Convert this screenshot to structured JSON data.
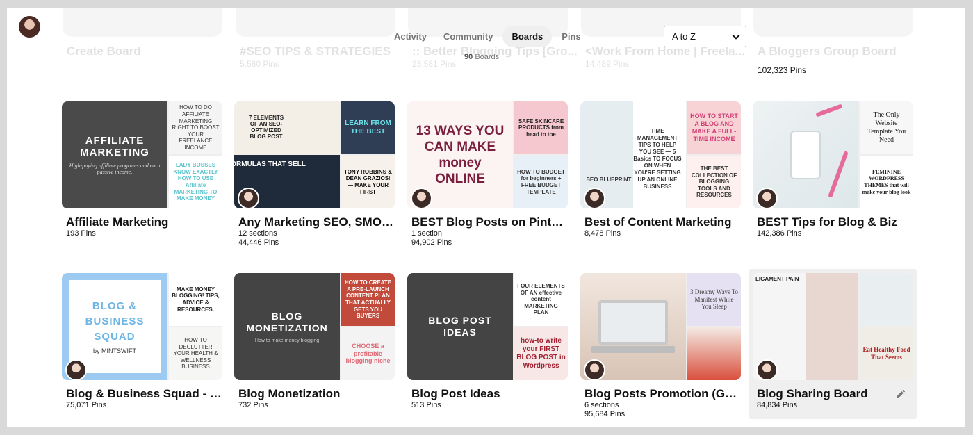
{
  "header": {
    "tabs": [
      {
        "label": "Activity"
      },
      {
        "label": "Community"
      },
      {
        "label": "Boards"
      },
      {
        "label": "Pins"
      }
    ],
    "count_number": "90",
    "count_unit": "Boards",
    "sort_value": "A to Z"
  },
  "faded_row": [
    {
      "title": "Create Board",
      "sub": ""
    },
    {
      "title": "#SEO TIPS & STRATEGIES",
      "sub": "5,580 Pins"
    },
    {
      "title": ":: Better Blogging Tips [Gro...",
      "sub": "23,581 Pins"
    },
    {
      "title": "<Work From Home | Freela...",
      "sub": "14,489 Pins"
    },
    {
      "title": "A Bloggers Group Board",
      "sub": ""
    }
  ],
  "faded_row_pins_visible": "102,323 Pins",
  "boards": [
    {
      "title": "Affiliate Marketing",
      "line1": "193 Pins",
      "line2": "",
      "main": {
        "heading": "AFFILIATE MARKETING",
        "sub": "High-paying affiliate programs and earn passive income."
      },
      "side_a": "HOW TO DO AFFILIATE MARKETING RIGHT TO BOOST YOUR FREELANCE INCOME",
      "side_b": "LADY BOSSES KNOW EXACTLY HOW TO USE Affiliate MARKETING TO MAKE MONEY"
    },
    {
      "title": "Any Marketing SEO, SMO A...",
      "line1": "12 sections",
      "line2": "44,446 Pins",
      "main": {
        "heading": "7 ELEMENTS OF AN SEO-OPTIMIZED BLOG POST",
        "sub": "FORMULAS THAT SELL"
      },
      "side_a": "LEARN FROM THE BEST",
      "side_b": "TONY ROBBINS & DEAN GRAZIOSI — MAKE YOUR FIRST"
    },
    {
      "title": "BEST Blog Posts on Pinterest",
      "line1": "1 section",
      "line2": "94,902 Pins",
      "main": {
        "heading": "13 WAYS YOU CAN MAKE money ONLINE",
        "sub": ""
      },
      "side_a": "SAFE SKINCARE PRODUCTS from head to toe",
      "side_b": "HOW TO BUDGET for beginners + FREE BUDGET TEMPLATE"
    },
    {
      "title": "Best of Content Marketing",
      "line1": "8,478 Pins",
      "line2": "",
      "main": {
        "heading": "TIME MANAGEMENT TIPS TO HELP YOU SEE — 5 Basics TO FOCUS ON WHEN YOU'RE SETTING UP AN ONLINE BUSINESS",
        "sub": "SEO BLUEPRINT"
      },
      "side_a": "HOW TO START A BLOG AND MAKE A FULL-TIME INCOME",
      "side_b": "THE BEST COLLECTION OF BLOGGING TOOLS AND RESOURCES"
    },
    {
      "title": "BEST Tips for Blog & Biz",
      "line1": "142,386 Pins",
      "line2": "",
      "main": {
        "heading": "",
        "sub": ""
      },
      "side_a": "The Only Website Template You Need",
      "side_b": "FEMININE WORDPRESS THEMES that will make your blog look"
    },
    {
      "title": "Blog & Business Squad - M...",
      "line1": "75,071 Pins",
      "line2": "",
      "main": {
        "heading": "BLOG & BUSINESS SQUAD",
        "sub": "by MINTSWIFT"
      },
      "side_a": "MAKE MONEY BLOGGING! TIPS, ADVICE & RESOURCES.",
      "side_b": "HOW TO DECLUTTER YOUR HEALTH & WELLNESS BUSINESS"
    },
    {
      "title": "Blog Monetization",
      "line1": "732 Pins",
      "line2": "",
      "main": {
        "heading": "BLOG MONETIZATION",
        "sub": "How to make money blogging"
      },
      "side_a": "HOW TO CREATE A PRE-LAUNCH CONTENT PLAN THAT ACTUALLY GETS YOU BUYERS",
      "side_b": "CHOOSE a profitable blogging niche"
    },
    {
      "title": "Blog Post Ideas",
      "line1": "513 Pins",
      "line2": "",
      "main": {
        "heading": "BLOG POST IDEAS",
        "sub": ""
      },
      "side_a": "FOUR ELEMENTS OF AN effective content MARKETING PLAN",
      "side_b": "how-to write your FIRST BLOG POST in Wordpress"
    },
    {
      "title": "Blog Posts Promotion (Gro...",
      "line1": "6 sections",
      "line2": "95,684 Pins",
      "main": {
        "heading": "",
        "sub": ""
      },
      "side_a": "3 Dreamy Ways To Manifest While You Sleep",
      "side_b": ""
    },
    {
      "title": "Blog Sharing Board",
      "line1": "84,834 Pins",
      "line2": "",
      "main": {
        "heading": "LIGAMENT PAIN",
        "sub": ""
      },
      "side_a": "",
      "side_b": "Eat Healthy Food That Seems"
    }
  ],
  "colors": {
    "affiliate_bg": "#4a4a4a",
    "dark_grey": "#444444",
    "pink": "#f2c5c9",
    "blue_squad": "#9ccaf0",
    "money_pink": "#d23c74",
    "teal": "#72cfd6"
  }
}
